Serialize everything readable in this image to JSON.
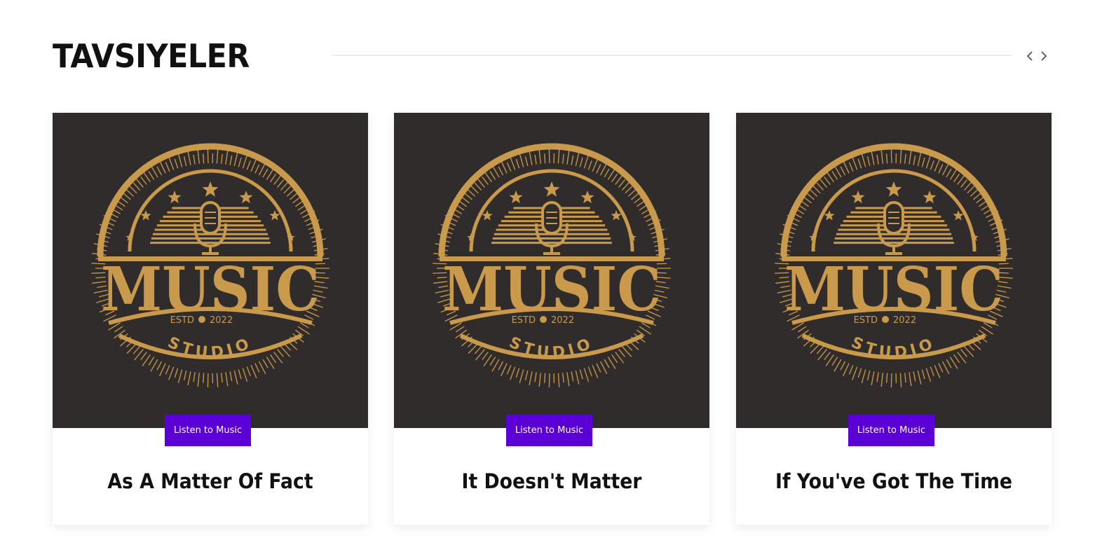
{
  "section": {
    "title": "TAVSIYELER",
    "nav": {
      "prev_icon": "chevron-left-icon",
      "next_icon": "chevron-right-icon"
    }
  },
  "logo": {
    "word": "MUSIC",
    "sub": "ESTD",
    "year": "2022",
    "studio": "STUDIO"
  },
  "cards": [
    {
      "button_label": "Listen to Music",
      "title": "As A Matter Of Fact"
    },
    {
      "button_label": "Listen to Music",
      "title": "It Doesn't Matter"
    },
    {
      "button_label": "Listen to Music",
      "title": "If You've Got The Time"
    }
  ],
  "colors": {
    "accent": "#5a00d6",
    "logo_gold": "#c99a4b",
    "image_bg": "#312c2c",
    "title_text": "#111111"
  }
}
